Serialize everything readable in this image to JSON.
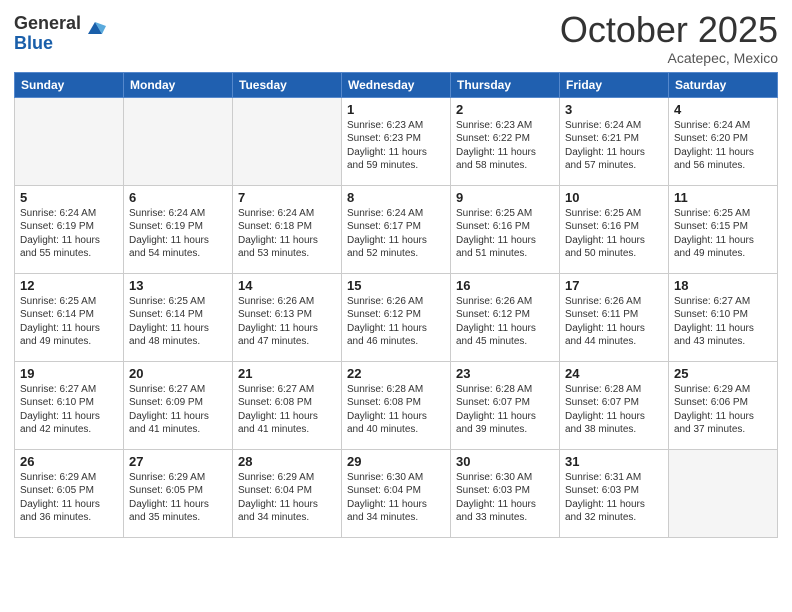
{
  "logo": {
    "general": "General",
    "blue": "Blue"
  },
  "header": {
    "month": "October 2025",
    "location": "Acatepec, Mexico"
  },
  "weekdays": [
    "Sunday",
    "Monday",
    "Tuesday",
    "Wednesday",
    "Thursday",
    "Friday",
    "Saturday"
  ],
  "weeks": [
    [
      {
        "day": "",
        "info": ""
      },
      {
        "day": "",
        "info": ""
      },
      {
        "day": "",
        "info": ""
      },
      {
        "day": "1",
        "info": "Sunrise: 6:23 AM\nSunset: 6:23 PM\nDaylight: 11 hours\nand 59 minutes."
      },
      {
        "day": "2",
        "info": "Sunrise: 6:23 AM\nSunset: 6:22 PM\nDaylight: 11 hours\nand 58 minutes."
      },
      {
        "day": "3",
        "info": "Sunrise: 6:24 AM\nSunset: 6:21 PM\nDaylight: 11 hours\nand 57 minutes."
      },
      {
        "day": "4",
        "info": "Sunrise: 6:24 AM\nSunset: 6:20 PM\nDaylight: 11 hours\nand 56 minutes."
      }
    ],
    [
      {
        "day": "5",
        "info": "Sunrise: 6:24 AM\nSunset: 6:19 PM\nDaylight: 11 hours\nand 55 minutes."
      },
      {
        "day": "6",
        "info": "Sunrise: 6:24 AM\nSunset: 6:19 PM\nDaylight: 11 hours\nand 54 minutes."
      },
      {
        "day": "7",
        "info": "Sunrise: 6:24 AM\nSunset: 6:18 PM\nDaylight: 11 hours\nand 53 minutes."
      },
      {
        "day": "8",
        "info": "Sunrise: 6:24 AM\nSunset: 6:17 PM\nDaylight: 11 hours\nand 52 minutes."
      },
      {
        "day": "9",
        "info": "Sunrise: 6:25 AM\nSunset: 6:16 PM\nDaylight: 11 hours\nand 51 minutes."
      },
      {
        "day": "10",
        "info": "Sunrise: 6:25 AM\nSunset: 6:16 PM\nDaylight: 11 hours\nand 50 minutes."
      },
      {
        "day": "11",
        "info": "Sunrise: 6:25 AM\nSunset: 6:15 PM\nDaylight: 11 hours\nand 49 minutes."
      }
    ],
    [
      {
        "day": "12",
        "info": "Sunrise: 6:25 AM\nSunset: 6:14 PM\nDaylight: 11 hours\nand 49 minutes."
      },
      {
        "day": "13",
        "info": "Sunrise: 6:25 AM\nSunset: 6:14 PM\nDaylight: 11 hours\nand 48 minutes."
      },
      {
        "day": "14",
        "info": "Sunrise: 6:26 AM\nSunset: 6:13 PM\nDaylight: 11 hours\nand 47 minutes."
      },
      {
        "day": "15",
        "info": "Sunrise: 6:26 AM\nSunset: 6:12 PM\nDaylight: 11 hours\nand 46 minutes."
      },
      {
        "day": "16",
        "info": "Sunrise: 6:26 AM\nSunset: 6:12 PM\nDaylight: 11 hours\nand 45 minutes."
      },
      {
        "day": "17",
        "info": "Sunrise: 6:26 AM\nSunset: 6:11 PM\nDaylight: 11 hours\nand 44 minutes."
      },
      {
        "day": "18",
        "info": "Sunrise: 6:27 AM\nSunset: 6:10 PM\nDaylight: 11 hours\nand 43 minutes."
      }
    ],
    [
      {
        "day": "19",
        "info": "Sunrise: 6:27 AM\nSunset: 6:10 PM\nDaylight: 11 hours\nand 42 minutes."
      },
      {
        "day": "20",
        "info": "Sunrise: 6:27 AM\nSunset: 6:09 PM\nDaylight: 11 hours\nand 41 minutes."
      },
      {
        "day": "21",
        "info": "Sunrise: 6:27 AM\nSunset: 6:08 PM\nDaylight: 11 hours\nand 41 minutes."
      },
      {
        "day": "22",
        "info": "Sunrise: 6:28 AM\nSunset: 6:08 PM\nDaylight: 11 hours\nand 40 minutes."
      },
      {
        "day": "23",
        "info": "Sunrise: 6:28 AM\nSunset: 6:07 PM\nDaylight: 11 hours\nand 39 minutes."
      },
      {
        "day": "24",
        "info": "Sunrise: 6:28 AM\nSunset: 6:07 PM\nDaylight: 11 hours\nand 38 minutes."
      },
      {
        "day": "25",
        "info": "Sunrise: 6:29 AM\nSunset: 6:06 PM\nDaylight: 11 hours\nand 37 minutes."
      }
    ],
    [
      {
        "day": "26",
        "info": "Sunrise: 6:29 AM\nSunset: 6:05 PM\nDaylight: 11 hours\nand 36 minutes."
      },
      {
        "day": "27",
        "info": "Sunrise: 6:29 AM\nSunset: 6:05 PM\nDaylight: 11 hours\nand 35 minutes."
      },
      {
        "day": "28",
        "info": "Sunrise: 6:29 AM\nSunset: 6:04 PM\nDaylight: 11 hours\nand 34 minutes."
      },
      {
        "day": "29",
        "info": "Sunrise: 6:30 AM\nSunset: 6:04 PM\nDaylight: 11 hours\nand 34 minutes."
      },
      {
        "day": "30",
        "info": "Sunrise: 6:30 AM\nSunset: 6:03 PM\nDaylight: 11 hours\nand 33 minutes."
      },
      {
        "day": "31",
        "info": "Sunrise: 6:31 AM\nSunset: 6:03 PM\nDaylight: 11 hours\nand 32 minutes."
      },
      {
        "day": "",
        "info": ""
      }
    ]
  ]
}
